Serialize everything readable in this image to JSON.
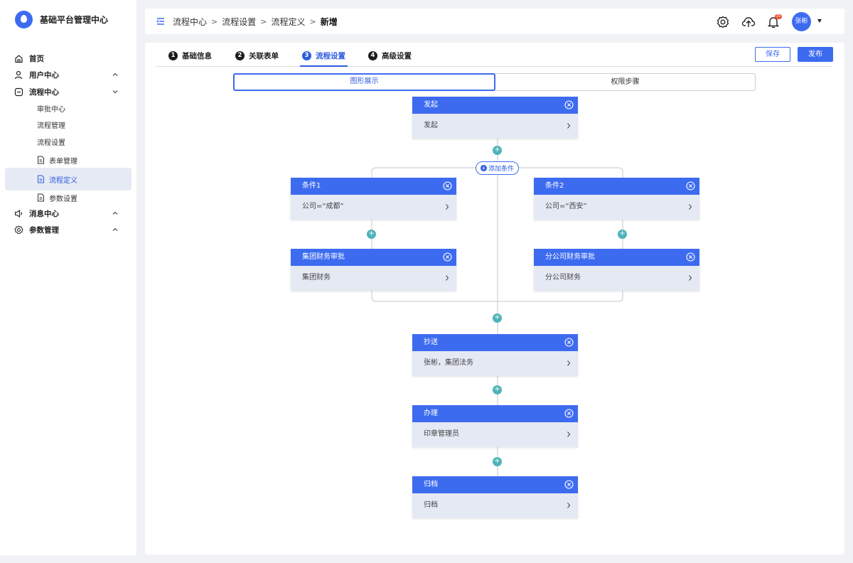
{
  "app": {
    "title": "基础平台管理中心"
  },
  "sidebar": {
    "items": [
      {
        "label": "首页",
        "icon": "home-icon"
      },
      {
        "label": "用户中心",
        "icon": "user-icon"
      },
      {
        "label": "流程中心",
        "icon": "workflow-icon"
      },
      {
        "label": "消息中心",
        "icon": "speaker-icon"
      },
      {
        "label": "参数管理",
        "icon": "gear-icon"
      }
    ],
    "flow_sub": [
      "审批中心",
      "流程管理",
      "流程设置"
    ],
    "flow_settings_sub": [
      "表单管理",
      "流程定义",
      "参数设置"
    ]
  },
  "header": {
    "breadcrumb": [
      "流程中心",
      "流程设置",
      "流程定义",
      "新增"
    ],
    "notification_count": "15",
    "user_name": "张彬"
  },
  "steps": [
    {
      "num": "1",
      "label": "基础信息"
    },
    {
      "num": "2",
      "label": "关联表单"
    },
    {
      "num": "3",
      "label": "流程设置"
    },
    {
      "num": "4",
      "label": "高级设置"
    }
  ],
  "actions": {
    "save": "保存",
    "publish": "发布"
  },
  "view_tabs": [
    "图形展示",
    "权限步骤"
  ],
  "flow": {
    "add_condition": "添加条件",
    "plus": "+",
    "nodes": {
      "start": {
        "title": "发起",
        "body": "发起"
      },
      "cond1": {
        "title": "条件1",
        "body": "公司=“成都”"
      },
      "cond2": {
        "title": "条件2",
        "body": "公司=“西安”"
      },
      "group_fin": {
        "title": "集团财务审批",
        "body": "集团财务"
      },
      "branch_fin": {
        "title": "分公司财务审批",
        "body": "分公司财务"
      },
      "cc": {
        "title": "抄送",
        "body": "张彬，集团法务"
      },
      "handle": {
        "title": "办理",
        "body": "印章管理员"
      },
      "archive": {
        "title": "归档",
        "body": "归档"
      }
    }
  },
  "colors": {
    "primary": "#3d6bf0",
    "plus": "#4fb3ba",
    "card_bg": "#e5e9f4",
    "badge": "#f3542d"
  }
}
